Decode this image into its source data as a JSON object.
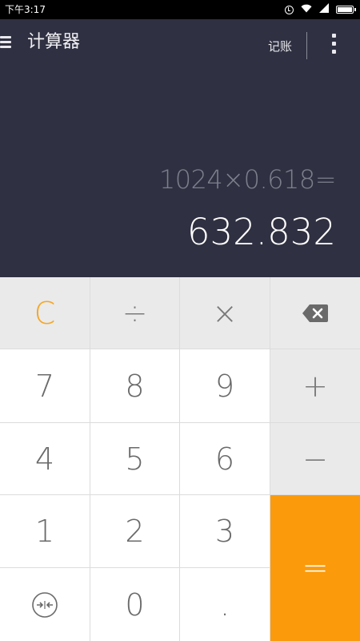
{
  "status_bar": {
    "time": "下午3:17",
    "icons": [
      "alarm-icon",
      "wifi-icon",
      "signal-icon",
      "battery-icon"
    ]
  },
  "app_bar": {
    "menu_icon": "hamburger-menu-icon",
    "title": "计算器",
    "ledger_label": "记账",
    "more_icon": "more-vertical-icon"
  },
  "display": {
    "expression": "1024×0.618=",
    "result": "632.832"
  },
  "keypad": {
    "row1": [
      "C",
      "÷",
      "×",
      "backspace-icon"
    ],
    "row2": [
      "7",
      "8",
      "9",
      "+"
    ],
    "row3": [
      "4",
      "5",
      "6",
      "−"
    ],
    "row4": [
      "1",
      "2",
      "3",
      "="
    ],
    "row5": [
      "collapse-icon",
      "0",
      "."
    ]
  },
  "colors": {
    "display_background": "#2f3041",
    "accent_orange": "#fb9a0b",
    "clear_orange": "#f6a623",
    "operator_key_background": "#eaeaea",
    "digit_key_background": "#ffffff"
  }
}
